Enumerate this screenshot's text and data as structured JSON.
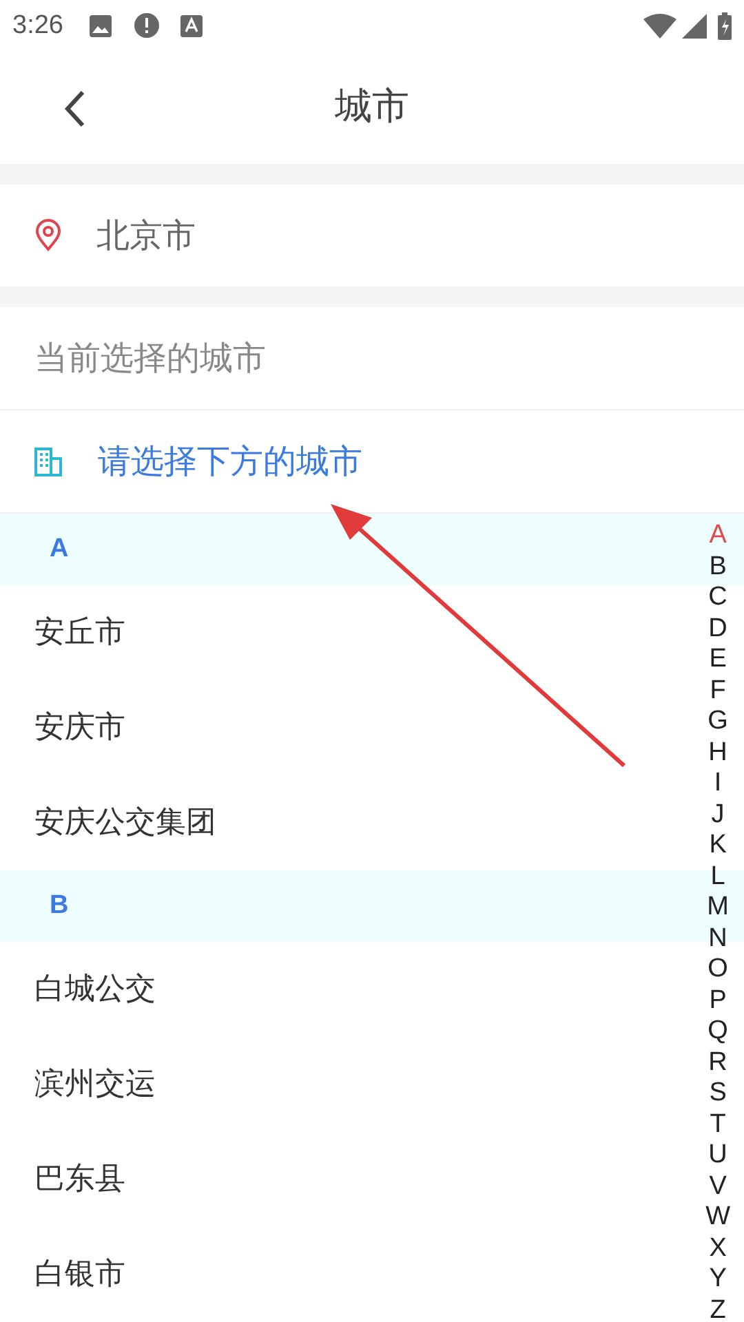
{
  "status_bar": {
    "time": "3:26"
  },
  "header": {
    "title": "城市"
  },
  "location": {
    "city": "北京市"
  },
  "current_label": "当前选择的城市",
  "prompt": "请选择下方的城市",
  "sections": [
    {
      "letter": "A",
      "cities": [
        "安丘市",
        "安庆市",
        "安庆公交集团"
      ]
    },
    {
      "letter": "B",
      "cities": [
        "白城公交",
        "滨州交运",
        "巴东县",
        "白银市"
      ]
    }
  ],
  "index": [
    {
      "letter": "A",
      "selected": true
    },
    {
      "letter": "B",
      "selected": false
    },
    {
      "letter": "C",
      "selected": false
    },
    {
      "letter": "D",
      "selected": false
    },
    {
      "letter": "E",
      "selected": false
    },
    {
      "letter": "F",
      "selected": false
    },
    {
      "letter": "G",
      "selected": false
    },
    {
      "letter": "H",
      "selected": false
    },
    {
      "letter": "I",
      "selected": false
    },
    {
      "letter": "J",
      "selected": false
    },
    {
      "letter": "K",
      "selected": false
    },
    {
      "letter": "L",
      "selected": false
    },
    {
      "letter": "M",
      "selected": false
    },
    {
      "letter": "N",
      "selected": false
    },
    {
      "letter": "O",
      "selected": false
    },
    {
      "letter": "P",
      "selected": false
    },
    {
      "letter": "Q",
      "selected": false
    },
    {
      "letter": "R",
      "selected": false
    },
    {
      "letter": "S",
      "selected": false
    },
    {
      "letter": "T",
      "selected": false
    },
    {
      "letter": "U",
      "selected": false
    },
    {
      "letter": "V",
      "selected": false
    },
    {
      "letter": "W",
      "selected": false
    },
    {
      "letter": "X",
      "selected": false
    },
    {
      "letter": "Y",
      "selected": false
    },
    {
      "letter": "Z",
      "selected": false
    }
  ]
}
